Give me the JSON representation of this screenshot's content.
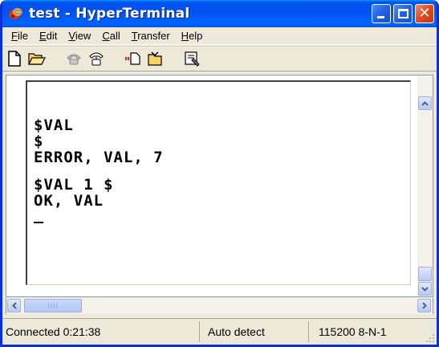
{
  "window": {
    "title": "test - HyperTerminal",
    "icon": "hyperterminal-icon"
  },
  "titlebar_buttons": {
    "minimize": "minimize-icon",
    "maximize": "maximize-icon",
    "close": "close-icon",
    "close_glyph": "✕"
  },
  "menu": {
    "items": [
      {
        "label_pre": "",
        "accel": "F",
        "label_post": "ile"
      },
      {
        "label_pre": "",
        "accel": "E",
        "label_post": "dit"
      },
      {
        "label_pre": "",
        "accel": "V",
        "label_post": "iew"
      },
      {
        "label_pre": "",
        "accel": "C",
        "label_post": "all"
      },
      {
        "label_pre": "",
        "accel": "T",
        "label_post": "ransfer"
      },
      {
        "label_pre": "",
        "accel": "H",
        "label_post": "elp"
      }
    ]
  },
  "toolbar": {
    "buttons": [
      "new-icon",
      "open-icon",
      "connect-icon",
      "disconnect-icon",
      "send-icon",
      "receive-icon",
      "properties-icon"
    ]
  },
  "terminal": {
    "lines": [
      "$VAL",
      "$",
      "ERROR, VAL, 7",
      "",
      "$VAL 1 $",
      "OK, VAL"
    ]
  },
  "scrollbars": {
    "thumb_grip": "IIII"
  },
  "status": {
    "connection": "Connected 0:21:38",
    "detect": "Auto detect",
    "settings": "115200 8-N-1"
  },
  "colors": {
    "titlebar": "#0053ee",
    "window_bg": "#ece9d8",
    "close_button": "#e2471d"
  }
}
